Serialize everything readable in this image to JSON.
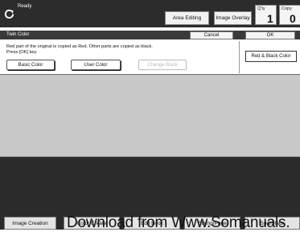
{
  "status": {
    "text": "Ready"
  },
  "toolbar": {
    "area_editing": "Area Editing",
    "image_overlay": "Image Overlay",
    "qty_label": "Q'ty",
    "qty_value": "1",
    "copy_label": "Copy",
    "copy_value": "0"
  },
  "dialog": {
    "title": "Twin Color",
    "cancel": "Cancel",
    "ok": "OK",
    "desc_line1": "Red part of the original is copied as Red. Other parts are copied as black.",
    "desc_line2": "Press [OK] key.",
    "basic_color": "Basic Color",
    "user_color": "User Color",
    "change_black": "Change Black",
    "selected_option": "Red & Black Color"
  },
  "tabs": [
    {
      "label": "Image Creation"
    },
    {
      "label": "Color Create"
    },
    {
      "label": "Edit Book"
    },
    {
      "label": "Stamp/Page"
    },
    {
      "label": "Sort/Stack"
    }
  ],
  "watermark": {
    "text": "Download from Www.Somanuals."
  }
}
